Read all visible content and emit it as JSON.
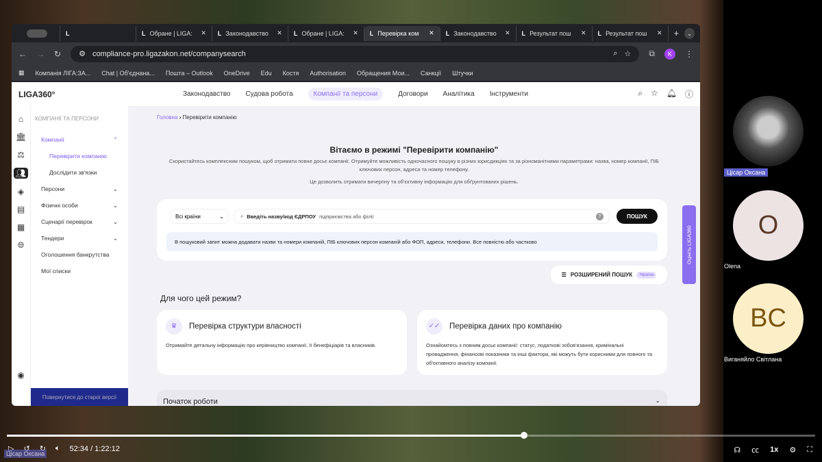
{
  "browser": {
    "tabs": [
      {
        "label": ""
      },
      {
        "label": "Обране | LIGA:"
      },
      {
        "label": "Законодавство"
      },
      {
        "label": "Обране | LIGA:"
      },
      {
        "label": "Перевірка ком"
      },
      {
        "label": "Законодавство"
      },
      {
        "label": "Результат пош"
      },
      {
        "label": "Результат пош"
      }
    ],
    "active_tab": 4,
    "url": "compliance-pro.ligazakon.net/companysearch",
    "profile_initial": "K",
    "bookmarks": [
      "Компанія ЛІГА:ЗА...",
      "Chat | Об'єднана...",
      "Пошта – Outlook",
      "OneDrive",
      "Edu",
      "Костя",
      "Authorisation",
      "Обращения Мои...",
      "Санкції",
      "Штучки"
    ]
  },
  "app": {
    "logo": "LIGA360°",
    "nav": [
      "Законодавство",
      "Судова робота",
      "Компанії та персони",
      "Договори",
      "Аналітика",
      "Інструменти"
    ],
    "menu": {
      "heading": "КОМПАНІЇ ТА ПЕРСОНИ",
      "items": [
        {
          "label": "Компанії",
          "chev": "⌃"
        },
        {
          "label": "Перевірити компанію",
          "chev": ""
        },
        {
          "label": "Дослідити зв'язки",
          "chev": ""
        },
        {
          "label": "Персони",
          "chev": "⌄"
        },
        {
          "label": "Фізичні особи",
          "chev": "⌄"
        },
        {
          "label": "Сценарії перевірок",
          "chev": "⌄"
        },
        {
          "label": "Тендери",
          "chev": "⌄"
        },
        {
          "label": "Оголошення банкрутства",
          "chev": ""
        },
        {
          "label": "Мої списки",
          "chev": ""
        }
      ],
      "back": "Повернутися до старої версії"
    },
    "breadcrumb": {
      "home": "Головна",
      "current": "Перевірити компанію"
    },
    "title": "Вітаємо в режимі \"Перевірити компанію\"",
    "desc": "Скористайтесь комплексним пошуком, щоб отримати повне досьє компанії. Отримуйте можливість одночасного пошуку в різних юрисдикціях та за різноманітними параметрами: назва, номер компанії, ПІБ ключових персон, адреса та номер телефону.",
    "desc2": "Це дозволить отримати вичерпну та об'єктивну інформацію для обґрунтованих рішень.",
    "search": {
      "country": "Всі країни",
      "placeholder_bold": "Введіть назву/код ЄДРПОУ",
      "placeholder_rest": "підприємства або філії",
      "button": "ПОШУК",
      "hint": "В пошуковий запит можна додавати назви та номери компаній, ПІБ ключових персон компаній або ФОП, адреси, телефони. Все повністю або частково"
    },
    "advanced": {
      "label": "РОЗШИРЕНИЙ ПОШУК",
      "tag": "Україна"
    },
    "why": "Для чого цей режим?",
    "cards": [
      {
        "title": "Перевірка структури власності",
        "text": "Отримайте детальну інформацію про керівництво компанії, її бенефіціарів та власників."
      },
      {
        "title": "Перевірка даних про компанію",
        "text": "Ознайомтесь з повним досьє компанії: статус, податкові зобов'язання, кримінальні провадження, фінансові показники та інші фактори, які можуть бути корисними для повного та об'єктивного аналізу компанії."
      }
    ],
    "start": "Початок роботи",
    "rate": "Оцініть LIGA360"
  },
  "participants": [
    {
      "name": "Цісар Оксана",
      "initials": "",
      "bg": "#333"
    },
    {
      "name": "Olena",
      "initials": "O",
      "bg": "#ede3e3",
      "fg": "#5a3a2a"
    },
    {
      "name": "Виганяйло Світлана",
      "initials": "BC",
      "bg": "#fcefc8",
      "fg": "#7a5510"
    }
  ],
  "player": {
    "time": "52:34 / 1:22:12",
    "progress": 0.64,
    "speed": "1x",
    "presenter": "Цісар Оксана"
  }
}
